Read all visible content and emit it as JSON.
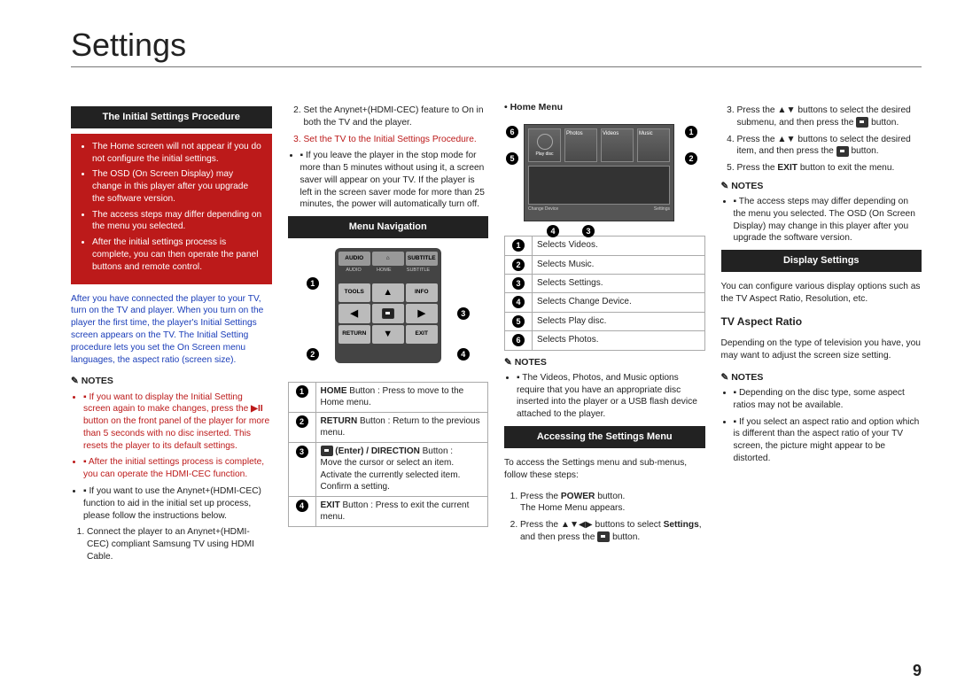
{
  "page_title": "Settings",
  "page_number": "9",
  "col1": {
    "header": "The Initial Settings Procedure",
    "redbox_items": [
      "The Home screen will not appear if you do not configure the initial settings.",
      "The OSD (On Screen Display) may change in this player after you upgrade the software version.",
      "The access steps may differ depending on the menu you selected.",
      "After the initial settings process is complete, you can then operate the panel buttons and remote control."
    ],
    "para_blue": "After you have connected the player to your TV, turn on the TV and player. When you turn on the player the first time, the player's Initial Settings screen appears on the TV. The Initial Setting procedure lets you set the On Screen menu languages, the aspect ratio (screen size).",
    "notes_label": "NOTES",
    "notes": [
      {
        "html": "If you want to display the Initial Setting screen again to make changes, press the <b>▶II</b> button on the front panel of the player for more than 5 seconds with no disc inserted. <span class='black'>This resets the player to its default settings.</span>",
        "red": true
      },
      {
        "html": "After the initial settings process is complete, you can operate the HDMI-CEC function.",
        "red": true
      },
      {
        "html": "If you want to use the Anynet+(HDMI-CEC) function to aid in the initial set up process, please follow the instructions below.",
        "red": false
      }
    ],
    "sublist": [
      "Connect the player to an Anynet+(HDMI-CEC) compliant Samsung TV using HDMI Cable."
    ]
  },
  "col2": {
    "cont_list": [
      "Set the Anynet+(HDMI-CEC) feature to On in both the TV and the player.",
      "Set the TV to the Initial Settings Procedure."
    ],
    "stop_bullet": "If you leave the player in the stop mode for more than 5 minutes without using it, a screen saver will appear on your TV. If the player is left in the screen saver mode for more than 25 minutes, the power will automatically turn off.",
    "menu_nav_header": "Menu Navigation",
    "remote_labels": {
      "audio": "AUDIO",
      "home": "HOME",
      "subtitle": "SUBTITLE",
      "tools": "TOOLS",
      "info": "INFO",
      "return": "RETURN",
      "exit": "EXIT"
    },
    "legend_nums": [
      "1",
      "2",
      "3",
      "4"
    ],
    "legend": [
      {
        "n": "1",
        "t": "<b>HOME</b> Button : Press to move to the Home menu."
      },
      {
        "n": "2",
        "t": "<b>RETURN</b> Button : Return to the previous menu."
      },
      {
        "n": "3",
        "t": "<span class='enter-icon'></span> <b>(Enter) / DIRECTION</b> Button :<br>Move the cursor or select an item.<br>Activate the currently selected item.<br>Confirm a setting."
      },
      {
        "n": "4",
        "t": "<b>EXIT</b> Button : Press to exit the current menu."
      }
    ]
  },
  "col3": {
    "home_menu_label": "Home Menu",
    "home_tiles": {
      "playdisc": "Play disc",
      "photos": "Photos",
      "videos": "Videos",
      "music": "Music",
      "foot_left": "Change Device",
      "foot_right": "Settings"
    },
    "callouts": [
      "1",
      "2",
      "3",
      "4",
      "5",
      "6"
    ],
    "home_legend": [
      {
        "n": "1",
        "t": "Selects Videos."
      },
      {
        "n": "2",
        "t": "Selects Music."
      },
      {
        "n": "3",
        "t": "Selects Settings."
      },
      {
        "n": "4",
        "t": "Selects Change Device."
      },
      {
        "n": "5",
        "t": "Selects Play disc."
      },
      {
        "n": "6",
        "t": "Selects Photos."
      }
    ],
    "notes_label": "NOTES",
    "note_text": "The Videos, Photos, and Music options require that you have an appropriate disc inserted into the player or a USB flash device attached to the player.",
    "access_header": "Accessing the Settings Menu",
    "access_intro": "To access the Settings menu and sub-menus, follow these steps:",
    "access_steps": [
      "Press the <b>POWER</b> button.<br>The Home Menu appears.",
      "Press the ▲▼◀▶ buttons to select <b>Settings</b>, and then press the <span class='enter-icon'></span> button."
    ]
  },
  "col4": {
    "cont_steps": [
      "Press the ▲▼ buttons to select the desired submenu, and then press the <span class='enter-icon'></span> button.",
      "Press the ▲▼ buttons to select the desired item, and then press the <span class='enter-icon'></span> button.",
      "Press the <b>EXIT</b> button to exit the menu."
    ],
    "notes_label": "NOTES",
    "note_text": "The access steps may differ depending on the menu you selected. The OSD (On Screen Display) may change in this player after you upgrade the software version.",
    "display_header": "Display Settings",
    "display_intro": "You can configure various display options such as the TV Aspect Ratio, Resolution, etc.",
    "aspect_header": "TV Aspect Ratio",
    "aspect_text": "Depending on the type of television you have, you may want to adjust the screen size setting.",
    "aspect_notes": [
      "Depending on the disc type, some aspect ratios may not be available.",
      "If you select an aspect ratio and option which is different than the aspect ratio of your TV screen, the picture might appear to be distorted."
    ]
  }
}
